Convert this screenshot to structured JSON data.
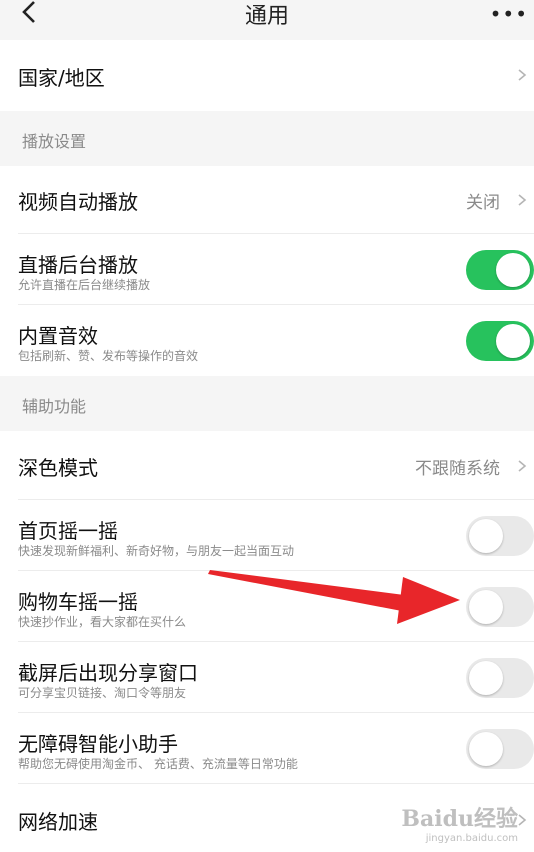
{
  "header": {
    "title": "通用",
    "more_icon": "•••"
  },
  "rows": {
    "country": {
      "label": "国家/地区"
    },
    "video_auto": {
      "label": "视频自动播放",
      "value": "关闭"
    },
    "live_bg": {
      "label": "直播后台播放",
      "sub": "允许直播在后台继续播放",
      "on": true
    },
    "builtin_sound": {
      "label": "内置音效",
      "sub": "包括刷新、赞、发布等操作的音效",
      "on": true
    },
    "dark_mode": {
      "label": "深色模式",
      "value": "不跟随系统"
    },
    "home_shake": {
      "label": "首页摇一摇",
      "sub": "快速发现新鲜福利、新奇好物，与朋友一起当面互动",
      "on": false
    },
    "cart_shake": {
      "label": "购物车摇一摇",
      "sub": "快速抄作业，看大家都在买什么",
      "on": false
    },
    "screenshot_share": {
      "label": "截屏后出现分享窗口",
      "sub": "可分享宝贝链接、淘口令等朋友",
      "on": false
    },
    "accessibility": {
      "label": "无障碍智能小助手",
      "sub": "帮助您无碍使用淘金币、 充话费、充流量等日常功能",
      "on": false
    },
    "network": {
      "label": "网络加速"
    }
  },
  "sections": {
    "playback": "播放设置",
    "assist": "辅助功能"
  },
  "colors": {
    "toggle_on": "#27c25d",
    "toggle_off": "#e9e9e9",
    "arrow": "#e8262a"
  },
  "watermark": {
    "brand": "Baidu经验",
    "url": "jingyan.baidu.com"
  }
}
